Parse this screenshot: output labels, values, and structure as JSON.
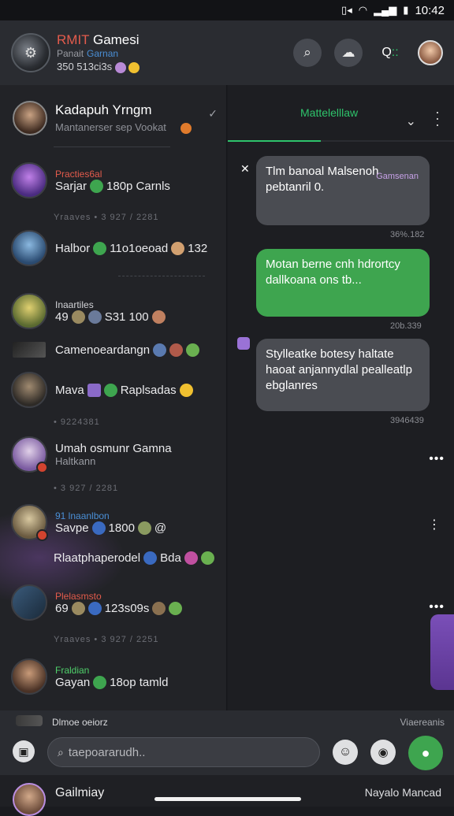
{
  "status_bar": {
    "time": "10:42"
  },
  "header": {
    "title_red": "RMIT",
    "title_rest": " Gamesi",
    "subtitle": "Panait",
    "subtitle_tag": "Garnan",
    "count": "350 513ci3s"
  },
  "pinned": {
    "name": "Kadapuh Yrngm",
    "sub": "Mantanerser sep Vookat"
  },
  "chats": [
    {
      "label": "Practies6al",
      "label_color": "#e35b4c",
      "msg": "Sarjar",
      "msg2": "180p Carnls",
      "stamp": "Yraaves • 3 927 / 2281"
    },
    {
      "label": "",
      "msg": "Halbor",
      "msg2": "11o1oeoad",
      "msg3": "132"
    },
    {
      "label": "Inaartiles",
      "label_color": "#d2d3d7",
      "msg": "49",
      "msg2": "S31 100"
    },
    {
      "label": "",
      "msg": "Camenoeardangn"
    },
    {
      "label": "",
      "msg": "Mava",
      "msg2": "Raplsadas",
      "stamp": "• 9224381"
    },
    {
      "label": "",
      "msg": "Umah osmunr Gamna",
      "msg_sub": "Haltkann",
      "stamp": "• 3 927 / 2281"
    },
    {
      "label": "91 lnaanlbon",
      "label_color": "#4a8fd6",
      "msg": "Savpe",
      "msg2": "1800",
      "msg3": "@"
    },
    {
      "label": "",
      "msg": "Rlaatphaperodel",
      "msg2": "Bda"
    },
    {
      "label": "Plelasmsto",
      "label_color": "#e35b4c",
      "msg": "69",
      "msg2": "123s09s",
      "stamp": "Yraaves • 3 927 / 2251"
    },
    {
      "label": "Fraldian",
      "label_color": "#4fcf6a",
      "msg": "Gayan",
      "msg2": "18op tamld"
    },
    {
      "label": "",
      "msg": "Dlmoe oeiorz"
    }
  ],
  "conversation": {
    "title": "Mattelelllaw",
    "messages": [
      {
        "text": "Tlm banoal Malsenoh pebtanril 0.",
        "meta": "Gamsenan",
        "time": "36%.182"
      },
      {
        "text": "Motan berne cnh hdrortcy dallkoana ons tb...",
        "time": "20b.339"
      },
      {
        "text": "Stylleatke botesy haltate haoat anjannydlal pealleatlp ebglanres",
        "time": "3946439"
      }
    ]
  },
  "bottom": {
    "left_label": "Dlmoe oeiorz",
    "right_label": "Viaereanis",
    "search_placeholder": "taepoararudh.."
  },
  "footer": {
    "name": "Gailmiay",
    "right": "Nayalo Mancad"
  }
}
